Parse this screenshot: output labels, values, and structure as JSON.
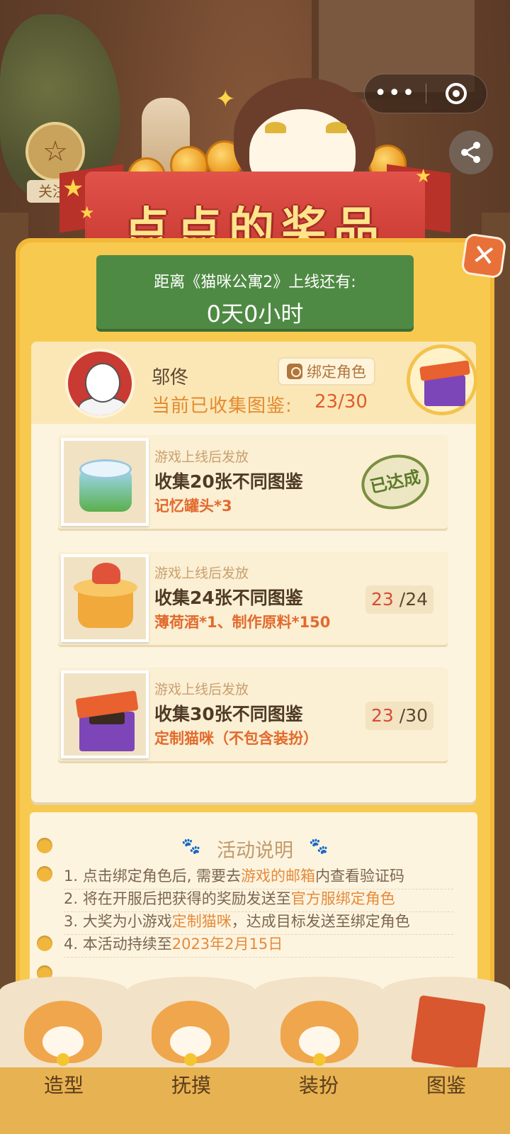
{
  "top_bar": {
    "more_glyph": "•••",
    "follow_label": "关注"
  },
  "banner": {
    "title": "点点的奖品"
  },
  "countdown": {
    "label": "距离《猫咪公寓2》上线还有:",
    "value": "0天0小时"
  },
  "user": {
    "name": "邬佟",
    "collected_label": "当前已收集图鉴:",
    "collected_count": "23/30",
    "bind_button": "绑定角色"
  },
  "rewards": [
    {
      "subtitle": "游戏上线后发放",
      "title": "收集20张不同图鉴",
      "prize": "记忆罐头*3",
      "status": "已达成"
    },
    {
      "subtitle": "游戏上线后发放",
      "title": "收集24张不同图鉴",
      "prize": "薄荷酒*1、制作原料*150",
      "progress_current": "23",
      "progress_total": "/24"
    },
    {
      "subtitle": "游戏上线后发放",
      "title": "收集30张不同图鉴",
      "prize": "定制猫咪（不包含装扮）",
      "progress_current": "23",
      "progress_total": "/30"
    }
  ],
  "description": {
    "title": "活动说明",
    "lines": [
      {
        "before": "1. 点击绑定角色后, 需要去",
        "highlight": "游戏的邮箱",
        "after": "内查看验证码"
      },
      {
        "before": "2. 将在开服后把获得的奖励发送至",
        "highlight": "官方服绑定角色",
        "after": ""
      },
      {
        "before": "3. 大奖为小游戏",
        "highlight": "定制猫咪",
        "after": "，达成目标发送至绑定角色"
      },
      {
        "before": "4. 本活动持续至",
        "highlight": "2023年2月15日",
        "after": ""
      }
    ]
  },
  "tabs": [
    {
      "label": "造型"
    },
    {
      "label": "抚摸"
    },
    {
      "label": "装扮"
    },
    {
      "label": "图鉴"
    }
  ],
  "colors": {
    "panel": "#f7c94e",
    "ribbon": "#c83a32",
    "countdown_bg": "#4f8a44",
    "highlight": "#e58a3a"
  }
}
